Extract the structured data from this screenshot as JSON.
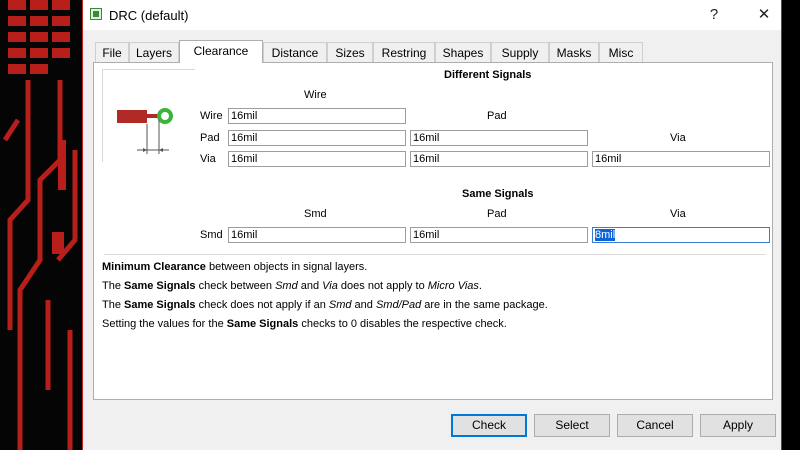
{
  "window": {
    "title": "DRC (default)",
    "help_glyph": "?",
    "close_glyph": "✕"
  },
  "tabs": [
    "File",
    "Layers",
    "Clearance",
    "Distance",
    "Sizes",
    "Restring",
    "Shapes",
    "Supply",
    "Masks",
    "Misc"
  ],
  "active_tab": "Clearance",
  "different_signals": {
    "heading": "Different Signals",
    "col_wire": "Wire",
    "col_pad": "Pad",
    "col_via": "Via",
    "row_wire": "Wire",
    "row_pad": "Pad",
    "row_via": "Via",
    "wire_wire": "16mil",
    "pad_wire": "16mil",
    "pad_pad": "16mil",
    "via_wire": "16mil",
    "via_pad": "16mil",
    "via_via": "16mil"
  },
  "same_signals": {
    "heading": "Same Signals",
    "col_smd": "Smd",
    "col_pad": "Pad",
    "col_via": "Via",
    "row_smd": "Smd",
    "smd_smd": "16mil",
    "smd_pad": "16mil",
    "smd_via": "8mil"
  },
  "description": [
    {
      "parts": [
        {
          "t": "Minimum Clearance",
          "b": true
        },
        {
          "t": " between objects in signal layers."
        }
      ]
    },
    {
      "parts": [
        {
          "t": "The "
        },
        {
          "t": "Same Signals",
          "b": true
        },
        {
          "t": " check between "
        },
        {
          "t": "Smd",
          "i": true
        },
        {
          "t": " and "
        },
        {
          "t": "Via",
          "i": true
        },
        {
          "t": " does not apply to "
        },
        {
          "t": "Micro Vias",
          "i": true
        },
        {
          "t": "."
        }
      ]
    },
    {
      "parts": [
        {
          "t": "The "
        },
        {
          "t": "Same Signals",
          "b": true
        },
        {
          "t": " check does not apply if an "
        },
        {
          "t": "Smd",
          "i": true
        },
        {
          "t": " and "
        },
        {
          "t": "Smd/Pad",
          "i": true
        },
        {
          "t": " are in the same package."
        }
      ]
    },
    {
      "parts": [
        {
          "t": "Setting the values for the "
        },
        {
          "t": "Same Signals",
          "b": true
        },
        {
          "t": " checks to 0 disables the respective check."
        }
      ]
    }
  ],
  "buttons": {
    "check": "Check",
    "select": "Select",
    "cancel": "Cancel",
    "apply": "Apply"
  },
  "colors": {
    "accent": "#0078d7",
    "pcb_trace": "#c0211c",
    "pad_ring": "#3ab53a"
  }
}
